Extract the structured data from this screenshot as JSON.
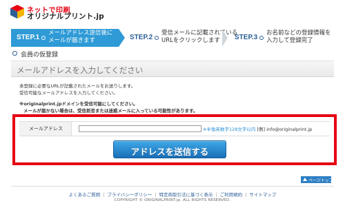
{
  "logo": {
    "line1": "ネットで印刷",
    "line2": "オリジナルプリント.jp"
  },
  "steps": [
    {
      "num": "STEP.1",
      "label1": "メールアドレス送信後に",
      "label2": "メールが届きます",
      "active": true
    },
    {
      "num": "STEP.2",
      "label1": "受信メールに記載されている",
      "label2": "URLをクリックします",
      "active": false
    },
    {
      "num": "STEP.3",
      "label1": "お名前などの登録情報を",
      "label2": "入力して登録完了",
      "active": false
    }
  ],
  "section": {
    "title": "会員の仮登録"
  },
  "title_bar": {
    "text": "メールアドレスを入力してください"
  },
  "notes": {
    "line1": "本登録に必要なURLが記載されたメールをお送りします。",
    "line2": "受信可能なメールアドレスを入力してください。",
    "line3": "※originalprint.jpドメインを受信可能にしてください。",
    "line4": "メールが届かない場合は、受信拒否または迷惑メールに入っている可能性があります。"
  },
  "form": {
    "email_label": "メールアドレス",
    "email_value": "",
    "hint_required": "※半角英数字128文字以内",
    "hint_example": "[例] info@originalprint.jp"
  },
  "submit_label": "アドレスを送信する",
  "page_top_label": "ページトップへ",
  "footer": {
    "links": [
      "よくあるご質問",
      "プライバシーポリシー",
      "特定商取引法に基づく表示",
      "ご利用規約",
      "サイトマップ"
    ],
    "copyright": "COPYRIGHT © ORIGINALPRINT.jp. ALL RIGHTS RESERVED."
  },
  "colors": {
    "accent_blue": "#2e9ad6",
    "highlight_red": "#e60012",
    "link_blue": "#2b5e96"
  }
}
